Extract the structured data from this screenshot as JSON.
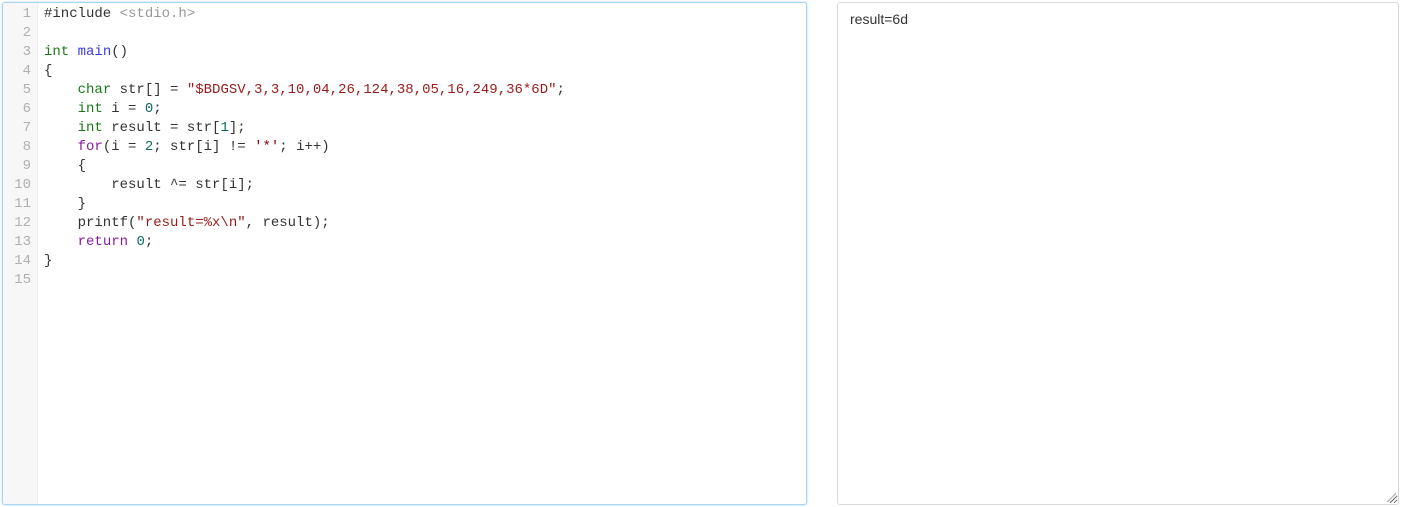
{
  "editor": {
    "lineCount": 15,
    "lines": [
      {
        "n": 1,
        "tokens": [
          {
            "cls": "tok-plain",
            "t": "#include "
          },
          {
            "cls": "tok-pp",
            "t": "<stdio.h>"
          }
        ]
      },
      {
        "n": 2,
        "tokens": []
      },
      {
        "n": 3,
        "tokens": [
          {
            "cls": "tok-kw2",
            "t": "int"
          },
          {
            "cls": "tok-plain",
            "t": " "
          },
          {
            "cls": "tok-fn",
            "t": "main"
          },
          {
            "cls": "tok-plain",
            "t": "()"
          }
        ]
      },
      {
        "n": 4,
        "tokens": [
          {
            "cls": "tok-plain",
            "t": "{"
          }
        ]
      },
      {
        "n": 5,
        "tokens": [
          {
            "cls": "tok-plain",
            "t": "    "
          },
          {
            "cls": "tok-kw2",
            "t": "char"
          },
          {
            "cls": "tok-plain",
            "t": " str[] = "
          },
          {
            "cls": "tok-str",
            "t": "\"$BDGSV,3,3,10,04,26,124,38,05,16,249,36*6D\""
          },
          {
            "cls": "tok-plain",
            "t": ";"
          }
        ]
      },
      {
        "n": 6,
        "tokens": [
          {
            "cls": "tok-plain",
            "t": "    "
          },
          {
            "cls": "tok-kw2",
            "t": "int"
          },
          {
            "cls": "tok-plain",
            "t": " i = "
          },
          {
            "cls": "tok-num",
            "t": "0"
          },
          {
            "cls": "tok-plain",
            "t": ";"
          }
        ]
      },
      {
        "n": 7,
        "tokens": [
          {
            "cls": "tok-plain",
            "t": "    "
          },
          {
            "cls": "tok-kw2",
            "t": "int"
          },
          {
            "cls": "tok-plain",
            "t": " result = str["
          },
          {
            "cls": "tok-num",
            "t": "1"
          },
          {
            "cls": "tok-plain",
            "t": "];"
          }
        ]
      },
      {
        "n": 8,
        "tokens": [
          {
            "cls": "tok-plain",
            "t": "    "
          },
          {
            "cls": "tok-kw",
            "t": "for"
          },
          {
            "cls": "tok-plain",
            "t": "(i = "
          },
          {
            "cls": "tok-num",
            "t": "2"
          },
          {
            "cls": "tok-plain",
            "t": "; str[i] != "
          },
          {
            "cls": "tok-char",
            "t": "'*'"
          },
          {
            "cls": "tok-plain",
            "t": "; i++)"
          }
        ]
      },
      {
        "n": 9,
        "tokens": [
          {
            "cls": "tok-plain",
            "t": "    {"
          }
        ]
      },
      {
        "n": 10,
        "tokens": [
          {
            "cls": "tok-plain",
            "t": "        result ^= str[i];"
          }
        ]
      },
      {
        "n": 11,
        "tokens": [
          {
            "cls": "tok-plain",
            "t": "    }"
          }
        ]
      },
      {
        "n": 12,
        "tokens": [
          {
            "cls": "tok-plain",
            "t": "    printf("
          },
          {
            "cls": "tok-str",
            "t": "\"result=%x\\n\""
          },
          {
            "cls": "tok-plain",
            "t": ", result);"
          }
        ]
      },
      {
        "n": 13,
        "tokens": [
          {
            "cls": "tok-plain",
            "t": "    "
          },
          {
            "cls": "tok-kw",
            "t": "return"
          },
          {
            "cls": "tok-plain",
            "t": " "
          },
          {
            "cls": "tok-num",
            "t": "0"
          },
          {
            "cls": "tok-plain",
            "t": ";"
          }
        ]
      },
      {
        "n": 14,
        "tokens": [
          {
            "cls": "tok-plain",
            "t": "}"
          }
        ]
      },
      {
        "n": 15,
        "tokens": []
      }
    ]
  },
  "output": {
    "text": "result=6d"
  }
}
